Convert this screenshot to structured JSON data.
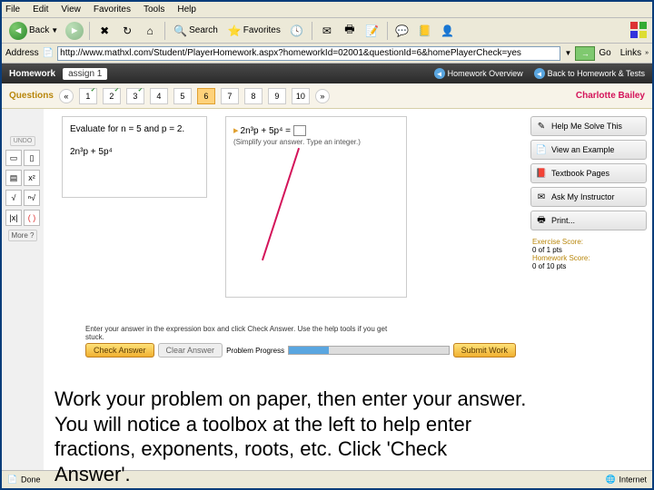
{
  "menu": {
    "file": "File",
    "edit": "Edit",
    "view": "View",
    "favorites": "Favorites",
    "tools": "Tools",
    "help": "Help"
  },
  "toolbar": {
    "back": "Back",
    "search": "Search",
    "favorites": "Favorites"
  },
  "address": {
    "label": "Address",
    "url": "http://www.mathxl.com/Student/PlayerHomework.aspx?homeworkId=02001&questionId=6&homePlayerCheck=yes",
    "go": "Go",
    "links": "Links"
  },
  "hw": {
    "title": "Homework",
    "assign": "assign 1",
    "overview": "Homework Overview",
    "back": "Back to Homework & Tests"
  },
  "q": {
    "label": "Questions",
    "nums": [
      "1",
      "2",
      "3",
      "4",
      "5",
      "6",
      "7",
      "8",
      "9",
      "10"
    ],
    "active": 5,
    "user": "Charlotte Bailey"
  },
  "rail": {
    "undo": "UNDO",
    "more": "More"
  },
  "problem": {
    "eval": "Evaluate for n = 5 and p = 2.",
    "expr": "2n³p + 5p⁴",
    "expr2": "2n³p + 5p⁴ =",
    "simplify": "(Simplify your answer. Type an integer.)"
  },
  "right": {
    "solve": "Help Me Solve This",
    "example": "View an Example",
    "textbook": "Textbook Pages",
    "ask": "Ask My Instructor",
    "print": "Print..."
  },
  "score": {
    "exlabel": "Exercise Score:",
    "exval": "0 of 1 pts",
    "hwlabel": "Homework Score:",
    "hwval": "0 of 10 pts"
  },
  "tip": "Enter your answer in the expression box and click Check Answer. Use the help tools if you get stuck.",
  "progress": {
    "label": "Problem Progress"
  },
  "buttons": {
    "check": "Check Answer",
    "clear": "Clear Answer",
    "submit": "Submit Work"
  },
  "overlay": "Work your problem on paper, then enter your answer.  You will notice a toolbox at the left to help enter fractions, exponents, roots, etc.  Click 'Check Answer'.",
  "status": {
    "done": "Done",
    "net": "Internet"
  }
}
